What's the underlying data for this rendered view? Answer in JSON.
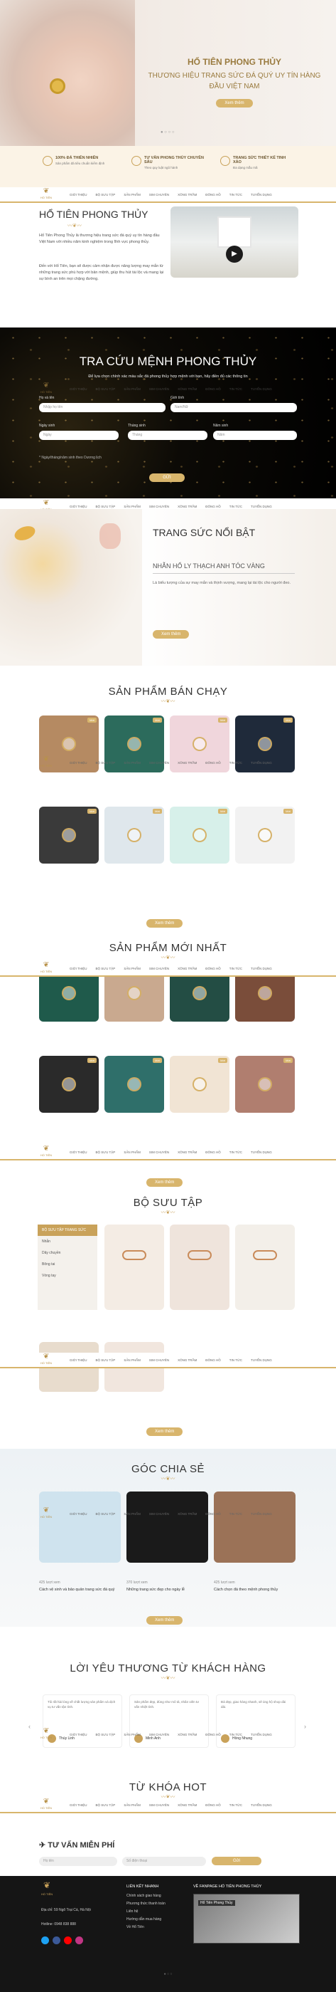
{
  "nav": {
    "items": [
      "GIỚI THIỆU",
      "BỘ SƯU TẬP",
      "SẢN PHẨM",
      "SIM CHUYÊN",
      "XÔNG TRẦM",
      "ĐÔNG HỒ",
      "TIN TỨC",
      "TUYỂN DỤNG"
    ],
    "logo": "HỔ TIÊN"
  },
  "hero": {
    "title": "HỔ TIÊN PHONG THỦY",
    "subtitle": "THƯƠNG HIỆU TRANG SỨC ĐÁ QUÝ UY TÍN HÀNG ĐẦU VIỆT NAM",
    "button": "Xem thêm"
  },
  "features": [
    {
      "title": "100% ĐÁ THIÊN NHIÊN",
      "desc": "Sản phẩm đá tiêu chuẩn kiểm định"
    },
    {
      "title": "TƯ VẤN PHONG THỦY CHUYÊN SÂU",
      "desc": "Theo quy luật ngũ hành"
    },
    {
      "title": "TRANG SỨC THIẾT KẾ TINH XẢO",
      "desc": "Đa dạng mẫu mã"
    }
  ],
  "about": {
    "title": "HỔ TIÊN PHONG THỦY",
    "p1": "Hổ Tiên Phong Thủy là thương hiệu trang sức đá quý uy tín hàng đầu Việt Nam với nhiều năm kinh nghiệm trong lĩnh vực phong thủy.",
    "p2": "Đến với Hổ Tiên, bạn sẽ được cảm nhận được năng lượng may mắn từ những trang sức phù hợp với bản mệnh, giúp thu hút tài lộc và mang lại sự bình an trên mọi chặng đường."
  },
  "lookup": {
    "title": "TRA CỨU MỆNH PHONG THỦY",
    "desc": "Để lựa chọn chính xác màu sắc đá phong thủy hợp mệnh với bạn, hãy điền đủ các thông tin",
    "fields": [
      {
        "label": "Họ và tên",
        "placeholder": "Nhập họ tên"
      },
      {
        "label": "Giới tính",
        "placeholder": "Nam/Nữ"
      },
      {
        "label": "Ngày sinh",
        "placeholder": "Ngày"
      },
      {
        "label": "Tháng sinh",
        "placeholder": "Tháng"
      },
      {
        "label": "Năm sinh",
        "placeholder": "Năm"
      }
    ],
    "note": "* Ngày/tháng/năm sinh theo Dương lịch",
    "button": "GỬI"
  },
  "featured": {
    "title": "TRANG SỨC NỔI BẬT",
    "product": "NHẪN HỔ LY THẠCH ANH TÓC VÀNG",
    "desc": "Là biểu tượng của sự may mắn và thịnh vượng, mang lại tài lộc cho người đeo.",
    "button": "Xem thêm"
  },
  "bestsellers": {
    "title": "SẢN PHẨM BÁN CHẠY",
    "tag": "Mới"
  },
  "newest": {
    "title": "SẢN PHẨM MỚI NHẤT"
  },
  "collection": {
    "title": "BỘ SƯU TẬP",
    "sidebar": [
      "BỘ SƯU TẬP TRANG SỨC",
      "Nhẫn",
      "Dây chuyền",
      "Bông tai",
      "Vòng tay"
    ]
  },
  "share": {
    "title": "GÓC CHIA SẺ",
    "posts": [
      {
        "views": "425 lượt xem",
        "title": "Cách vệ sinh và bảo quản trang sức đá quý"
      },
      {
        "views": "370 lượt xem",
        "title": "Những trang sức đẹp cho ngày lễ"
      },
      {
        "views": "425 lượt xem",
        "title": "Cách chọn đá theo mệnh phong thủy"
      }
    ],
    "button": "Xem thêm"
  },
  "testimonials": {
    "title": "LỜI YÊU THƯƠNG TỪ KHÁCH HÀNG",
    "items": [
      {
        "name": "Thùy Linh",
        "text": "Tôi rất hài lòng về chất lượng sản phẩm và dịch vụ tư vấn tận tình."
      },
      {
        "name": "Minh Anh",
        "text": "Sản phẩm đẹp, đúng như mô tả, nhân viên tư vấn nhiệt tình."
      },
      {
        "name": "Hồng Nhung",
        "text": "Đá đẹp, giao hàng nhanh, sẽ ủng hộ shop dài dài."
      }
    ]
  },
  "keywords": {
    "title": "TỪ KHÓA HOT"
  },
  "consult": {
    "title": "TƯ VẤN MIỄN PHÍ",
    "fields": [
      "Họ tên",
      "Số điện thoại"
    ],
    "button": "Gửi"
  },
  "footer": {
    "address": "Địa chỉ: 59 Ngõ Trại Cá, Hà Nội",
    "phone": "Hotline: 0948 838 888",
    "links_title": "LIÊN KẾT NHANH",
    "links": [
      "Chính sách giao hàng",
      "Phương thức thanh toán",
      "Liên hệ",
      "Hướng dẫn mua hàng",
      "Về Hổ Tiên"
    ],
    "fanpage_title": "VỀ FANPAGE HỔ TIÊN PHONG THỦY",
    "fanpage": "Hổ Tiên Phong Thủy"
  },
  "colors": {
    "gold": "#d8b56c",
    "dark": "#111111"
  }
}
